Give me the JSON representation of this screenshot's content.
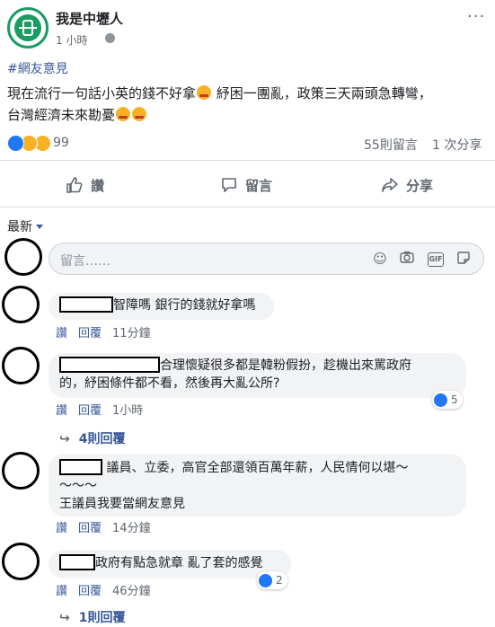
{
  "post": {
    "page_name": "我是中壢人",
    "time": "1 小時",
    "hashtag": "#網友意見",
    "text_line1": "現在流行一句話小英的錢不好拿",
    "text_line1b": " 紓困一團亂，政策三天兩頭急轉彎，",
    "text_line2": "台灣經濟未來勘憂",
    "reaction_count": "99",
    "comment_count": "55則留言",
    "share_count": "1 次分享",
    "more": "···"
  },
  "actions": {
    "like": "讚",
    "comment": "留言",
    "share": "分享"
  },
  "comments_section": {
    "sort": "最新",
    "input_placeholder": "留言……",
    "input_icons": [
      "smiley-icon",
      "camera-icon",
      "gif-icon",
      "sticker-icon"
    ]
  },
  "comments": [
    {
      "text": "智障嗎 銀行的錢就好拿嗎",
      "like": "讚",
      "reply": "回覆",
      "time": "11分鐘"
    },
    {
      "text1": "合理懷疑很多都是韓粉假扮，趁機出來罵政府",
      "text2": "的，紓困條件都不看，然後再大亂公所?",
      "like": "讚",
      "reply": "回覆",
      "time": "1小時",
      "reactions": "5",
      "replies": "4則回覆"
    },
    {
      "text1": "議員、立委，高官全部還領百萬年薪，人民情何以堪～",
      "text2": "～～～",
      "text3": "王議員我要當網友意見",
      "like": "讚",
      "reply": "回覆",
      "time": "14分鐘"
    },
    {
      "text": "政府有點急就章 亂了套的感覺",
      "like": "讚",
      "reply": "回覆",
      "time": "46分鐘",
      "reactions": "2",
      "replies": "1則回覆"
    }
  ],
  "colors": {
    "brand": "#1a9c63",
    "link": "#385898",
    "like_blue": "#2078f4",
    "bubble": "#f2f3f5"
  }
}
